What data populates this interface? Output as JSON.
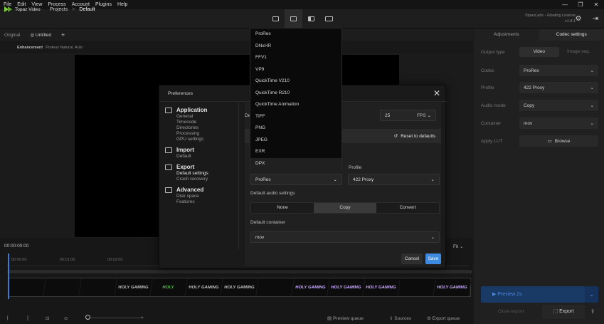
{
  "menu": [
    "File",
    "Edit",
    "View",
    "Process",
    "Account",
    "Plugins",
    "Help"
  ],
  "window_controls": [
    "—",
    "❐",
    "✕"
  ],
  "app": {
    "name": "Topaz Video"
  },
  "breadcrumb": {
    "projects": "Projects",
    "separator": ">",
    "current": "Default"
  },
  "license": {
    "line1": "TopazLabs - Floating License",
    "line2": "v1.8.1"
  },
  "view_tabs": {
    "original": "Original",
    "untitled": "Untitled",
    "add": "+"
  },
  "enhancement": {
    "label": "Enhancement",
    "value": "Proteus Natural, Auto"
  },
  "right_panel": {
    "tabs": [
      "Adjustments",
      "Codec settings"
    ],
    "output_type": {
      "label": "Output type",
      "options": [
        "Video",
        "Image seq."
      ]
    },
    "codec": {
      "label": "Codec",
      "value": "ProRes"
    },
    "profile": {
      "label": "Profile",
      "value": "422 Proxy"
    },
    "audio_mode": {
      "label": "Audio mode",
      "value": "Copy"
    },
    "container": {
      "label": "Container",
      "value": "mov"
    },
    "apply_lut": {
      "label": "Apply LUT",
      "button": "Browse"
    },
    "preview_label": "Preview 2s",
    "close_export": "Close export",
    "export": "Export"
  },
  "timeline": {
    "timecode": "00:00:00:00",
    "fit": "Fit",
    "ticks": [
      "00:00:00",
      "00:01:00",
      "00:02:00"
    ],
    "frames": [
      "",
      "",
      "",
      "HOLY GAMING",
      "HOLY",
      "HOLY GAMING",
      "HOLY GAMING",
      "",
      "HOLY GAMING",
      "HOLY GAMING",
      "HOLY GAMING",
      "",
      "HOLY GAMING"
    ],
    "bottom": {
      "preview_queue": "Preview queue",
      "sources": "Sources",
      "export_queue": "Export queue"
    }
  },
  "preferences": {
    "title": "Preferences",
    "nav": [
      {
        "heading": "Application",
        "items": [
          "General",
          "Timecode",
          "Directories",
          "Processing",
          "GPU settings"
        ]
      },
      {
        "heading": "Import",
        "items": [
          "Default"
        ]
      },
      {
        "heading": "Export",
        "items": [
          "Default settings",
          "Crash recovery"
        ]
      },
      {
        "heading": "Advanced",
        "items": [
          "Disk space",
          "Features"
        ]
      }
    ],
    "partial_label": "De",
    "fps": {
      "value": "25",
      "unit": "FPS"
    },
    "reset": "Reset to defaults",
    "codec_value": "ProRes",
    "profile": {
      "label": "Profile",
      "value": "422 Proxy"
    },
    "audio": {
      "label": "Default audio settings",
      "options": [
        "None",
        "Copy",
        "Convert"
      ],
      "selected": "Copy"
    },
    "container": {
      "label": "Default container",
      "value": "mov"
    },
    "cancel": "Cancel",
    "save": "Save"
  },
  "codec_dropdown": [
    "ProRes",
    "DNxHR",
    "FFV1",
    "VP9",
    "QuickTime V210",
    "QuickTime R210",
    "QuickTime Animation",
    "TIFF",
    "PNG",
    "JPEG",
    "EXR",
    "DPX"
  ],
  "colors": {
    "accent": "#3d8ae0",
    "logo": "#7fd13b",
    "preview_button": "#1a3a66"
  }
}
